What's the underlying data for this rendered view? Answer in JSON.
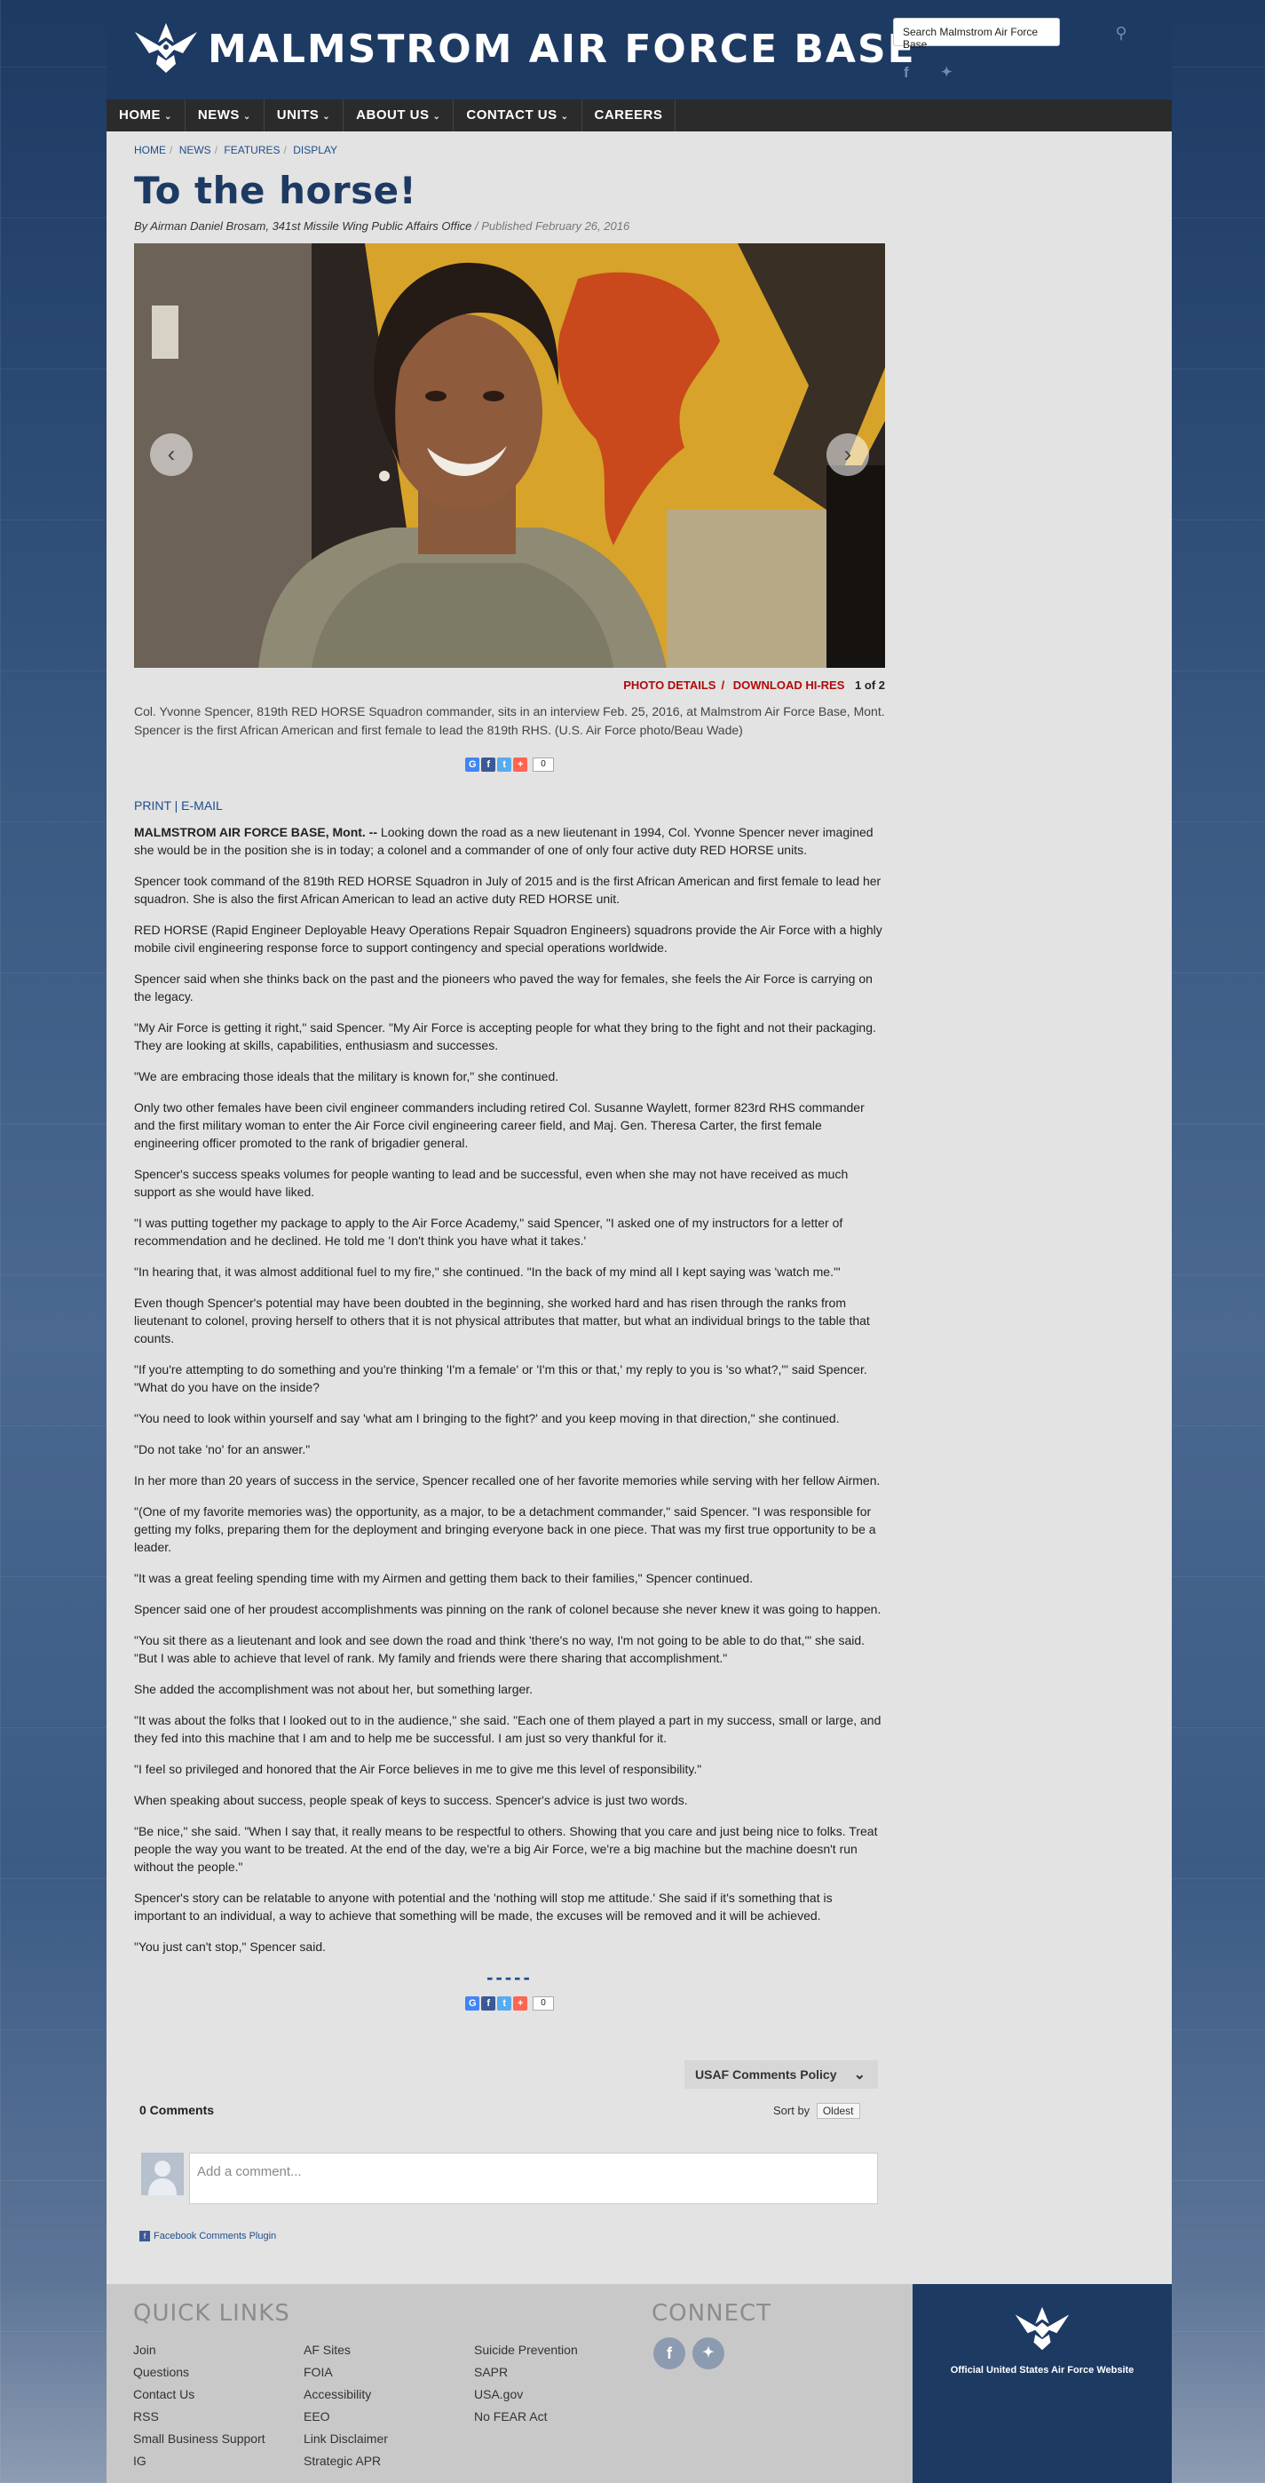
{
  "header": {
    "site_title": "MALMSTROM AIR FORCE BASE",
    "search_placeholder": "Search Malmstrom Air Force Base",
    "facebook_glyph": "f",
    "twitter_glyph": "t"
  },
  "nav": [
    {
      "label": "HOME"
    },
    {
      "label": "NEWS"
    },
    {
      "label": "UNITS"
    },
    {
      "label": "ABOUT US"
    },
    {
      "label": "CONTACT US"
    },
    {
      "label": "CAREERS"
    }
  ],
  "breadcrumb": [
    "HOME",
    "NEWS",
    "FEATURES",
    "DISPLAY"
  ],
  "article": {
    "title": "To the horse!",
    "byline": "By Airman Daniel Brosam, 341st Missile Wing Public Affairs Office",
    "published": "/ Published February 26, 2016",
    "photo_details": "PHOTO DETAILS",
    "download": "DOWNLOAD HI-RES",
    "photo_count": "1 of 2",
    "caption": "Col. Yvonne Spencer, 819th RED HORSE Squadron commander, sits in an interview Feb. 25, 2016, at Malmstrom Air Force Base, Mont. Spencer is the first African American and first female to lead the 819th RHS. (U.S. Air Force photo/Beau Wade)",
    "share_count": "0",
    "print": "PRINT",
    "email": "E-MAIL",
    "dateline": "MALMSTROM AIR FORCE BASE, Mont. --",
    "first_para": " Looking down the road as a new lieutenant in 1994, Col. Yvonne Spencer never imagined she would be in the position she is in today; a colonel and a commander of one of only four active duty RED HORSE units.",
    "paragraphs": [
      "Spencer took command of the 819th RED HORSE Squadron in July of 2015 and is the first African American and first female to lead her squadron. She is also the first African American to lead an active duty RED HORSE unit.",
      "RED HORSE (Rapid Engineer Deployable Heavy Operations Repair Squadron Engineers) squadrons provide the Air Force with a highly mobile civil engineering response force to support contingency and special operations worldwide.",
      "Spencer said when she thinks back on the past and the pioneers who paved the way for females, she feels the Air Force is carrying on the legacy.",
      "\"My Air Force is getting it right,\" said Spencer. \"My Air Force is accepting people for what they bring to the fight and not their packaging. They are looking at skills, capabilities, enthusiasm and successes.",
      "\"We are embracing those ideals that the military is known for,\" she continued.",
      "Only two other females have been civil engineer commanders including retired Col. Susanne Waylett, former 823rd RHS commander and the first military woman to enter the Air Force civil engineering career field, and Maj. Gen. Theresa Carter, the first female engineering officer promoted to the rank of brigadier general.",
      "Spencer's success speaks volumes for people wanting to lead and be successful, even when she may not have received as much support as she would have liked.",
      "\"I was putting together my package to apply to the Air Force Academy,\" said Spencer, \"I asked one of my instructors for a letter of recommendation and he declined. He told me 'I don't think you have what it takes.'",
      "\"In hearing that, it was almost additional fuel to my fire,\" she continued. \"In the back of my mind all I kept saying was 'watch me.'\"",
      "Even though Spencer's potential may have been doubted in the beginning, she worked hard and has risen through the ranks from lieutenant to colonel, proving herself to others that it is not physical attributes that matter, but what an individual brings to the table that counts.",
      "\"If you're attempting to do something and you're thinking 'I'm a female' or 'I'm this or that,' my reply to you is 'so what?,'\" said Spencer.  \"What do you have on the inside?",
      "\"You need to look within yourself and say 'what am I bringing to the fight?' and you keep moving in that direction,\" she continued.",
      "\"Do not take 'no' for an answer.\"",
      "In her more than 20 years of success in the service, Spencer recalled one of her favorite memories while serving with her fellow Airmen.",
      "\"(One of my favorite memories was) the opportunity, as a major, to be a detachment commander,\" said Spencer. \"I was responsible for getting my folks, preparing them for the deployment and bringing everyone back in one piece. That was my first true opportunity to be a leader.",
      "\"It was a great feeling spending time with my Airmen and getting them back to their families,\" Spencer continued.",
      "Spencer said one of her proudest accomplishments was pinning on the rank of colonel because she never knew it was going to happen.",
      "\"You sit there as a lieutenant and look and see down the road and think 'there's no way, I'm not going to be able to do that,'\" she said. \"But I was able to achieve that level of rank. My family and friends were there sharing that accomplishment.\"",
      "She added the accomplishment was not about her, but something larger.",
      "\"It was about the folks that I looked out to in the audience,\" she said. \"Each one of them played a part in my success, small or large, and they fed into this machine that I am and to help me be successful. I am just so very thankful for it.",
      "\"I feel so privileged and honored that the Air Force believes in me to give me this level of responsibility.\"",
      "When speaking about success, people speak of keys to success. Spencer's advice is just two words.",
      "\"Be nice,\" she said. \"When I say that, it really means to be respectful to others. Showing that you care and just being nice to folks. Treat people the way you want to be treated. At the end of the day, we're a big Air Force, we're a big machine but the machine doesn't run without the people.\"",
      "Spencer's story can be relatable to anyone with potential and the 'nothing will stop me attitude.' She said if it's something that is important to an individual, a way to achieve that something will be made, the excuses will be removed and it will be achieved.",
      "\"You just can't stop,\" Spencer said."
    ],
    "dashes": "-----"
  },
  "comments": {
    "policy": "USAF Comments Policy",
    "count": "0 Comments",
    "sort_label": "Sort by",
    "sort_value": "Oldest",
    "placeholder": "Add a comment...",
    "plugin": "Facebook Comments Plugin"
  },
  "footer": {
    "quick_links_title": "QUICK LINKS",
    "connect_title": "CONNECT",
    "col1": [
      "Join",
      "Questions",
      "Contact Us",
      "RSS",
      "Small Business Support",
      "IG"
    ],
    "col2": [
      "AF Sites",
      "FOIA",
      "Accessibility",
      "EEO",
      "Link Disclaimer",
      "Strategic APR"
    ],
    "col3": [
      "Suicide Prevention",
      "SAPR",
      "USA.gov",
      "No FEAR Act"
    ],
    "official": "Official United States Air Force Website"
  },
  "colors": {
    "brand_navy": "#1d3a63",
    "link_blue": "#1d4e8c",
    "photo_red": "#b00a0a"
  }
}
